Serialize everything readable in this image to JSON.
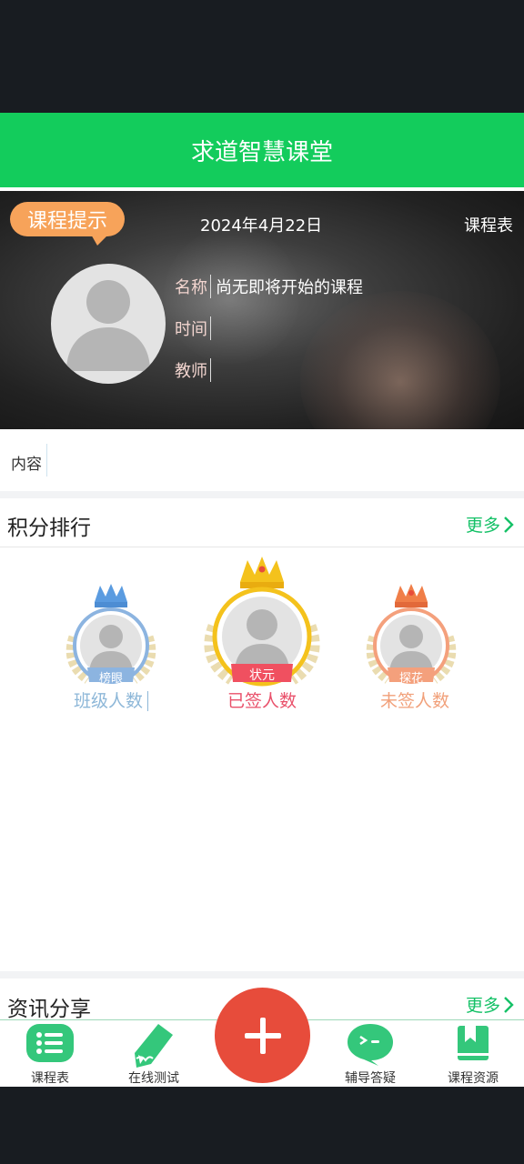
{
  "app": {
    "title": "求道智慧课堂"
  },
  "banner": {
    "tip_badge": "课程提示",
    "date": "2024年4月22日",
    "schedule_link": "课程表",
    "rows": [
      {
        "label": "名称",
        "value": "尚无即将开始的课程"
      },
      {
        "label": "时间",
        "value": ""
      },
      {
        "label": "教师",
        "value": ""
      }
    ]
  },
  "content": {
    "label": "内容",
    "value": ""
  },
  "ranking": {
    "title": "积分排行",
    "more": "更多",
    "medals": [
      {
        "badge": "榜眼",
        "label": "班级人数",
        "color": "#8db7d8"
      },
      {
        "badge": "状元",
        "label": "已签人数",
        "color": "#e9506a"
      },
      {
        "badge": "探花",
        "label": "未签人数",
        "color": "#f1a07a"
      }
    ]
  },
  "news": {
    "title": "资讯分享",
    "more": "更多"
  },
  "tabbar": {
    "items": [
      {
        "label": "课程表",
        "icon": "list-icon"
      },
      {
        "label": "在线测试",
        "icon": "pencil-icon"
      },
      {
        "label": "辅导答疑",
        "icon": "chat-icon"
      },
      {
        "label": "课程资源",
        "icon": "bookmark-book-icon"
      }
    ],
    "fab_icon": "plus-icon"
  },
  "colors": {
    "primary": "#13cc5c",
    "accent": "#e74c3b",
    "tip": "#f7a35a"
  }
}
